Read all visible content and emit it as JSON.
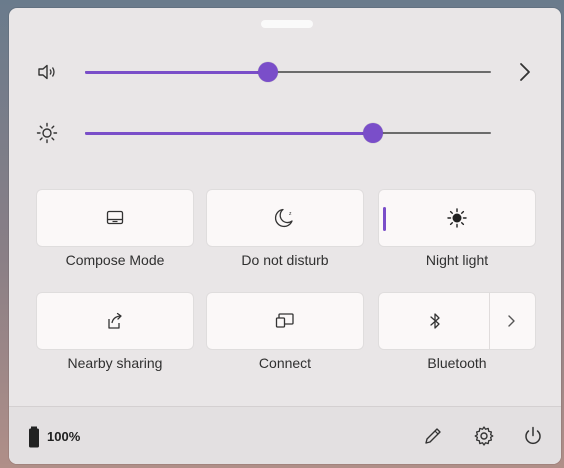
{
  "sliders": {
    "volume": {
      "icon": "speaker-icon",
      "value": 0.45
    },
    "brightness": {
      "icon": "sun-icon",
      "value": 0.71
    }
  },
  "tiles": [
    {
      "label": "Compose Mode",
      "icon": "compose-mode-icon",
      "active": false
    },
    {
      "label": "Do not disturb",
      "icon": "moon-icon",
      "active": false
    },
    {
      "label": "Night light",
      "icon": "night-light-icon",
      "active": true
    },
    {
      "label": "Nearby sharing",
      "icon": "share-icon",
      "active": false
    },
    {
      "label": "Connect",
      "icon": "cast-icon",
      "active": false
    },
    {
      "label": "Bluetooth",
      "icon": "bluetooth-icon",
      "active": false
    }
  ],
  "footer": {
    "battery_text": "100%",
    "battery_icon": "battery-icon",
    "edit_icon": "pencil-icon",
    "settings_icon": "gear-icon",
    "power_icon": "power-icon"
  },
  "colors": {
    "accent": "#7a4ec9",
    "panel": "#e9e6e7",
    "tile": "#fbf8f8"
  }
}
